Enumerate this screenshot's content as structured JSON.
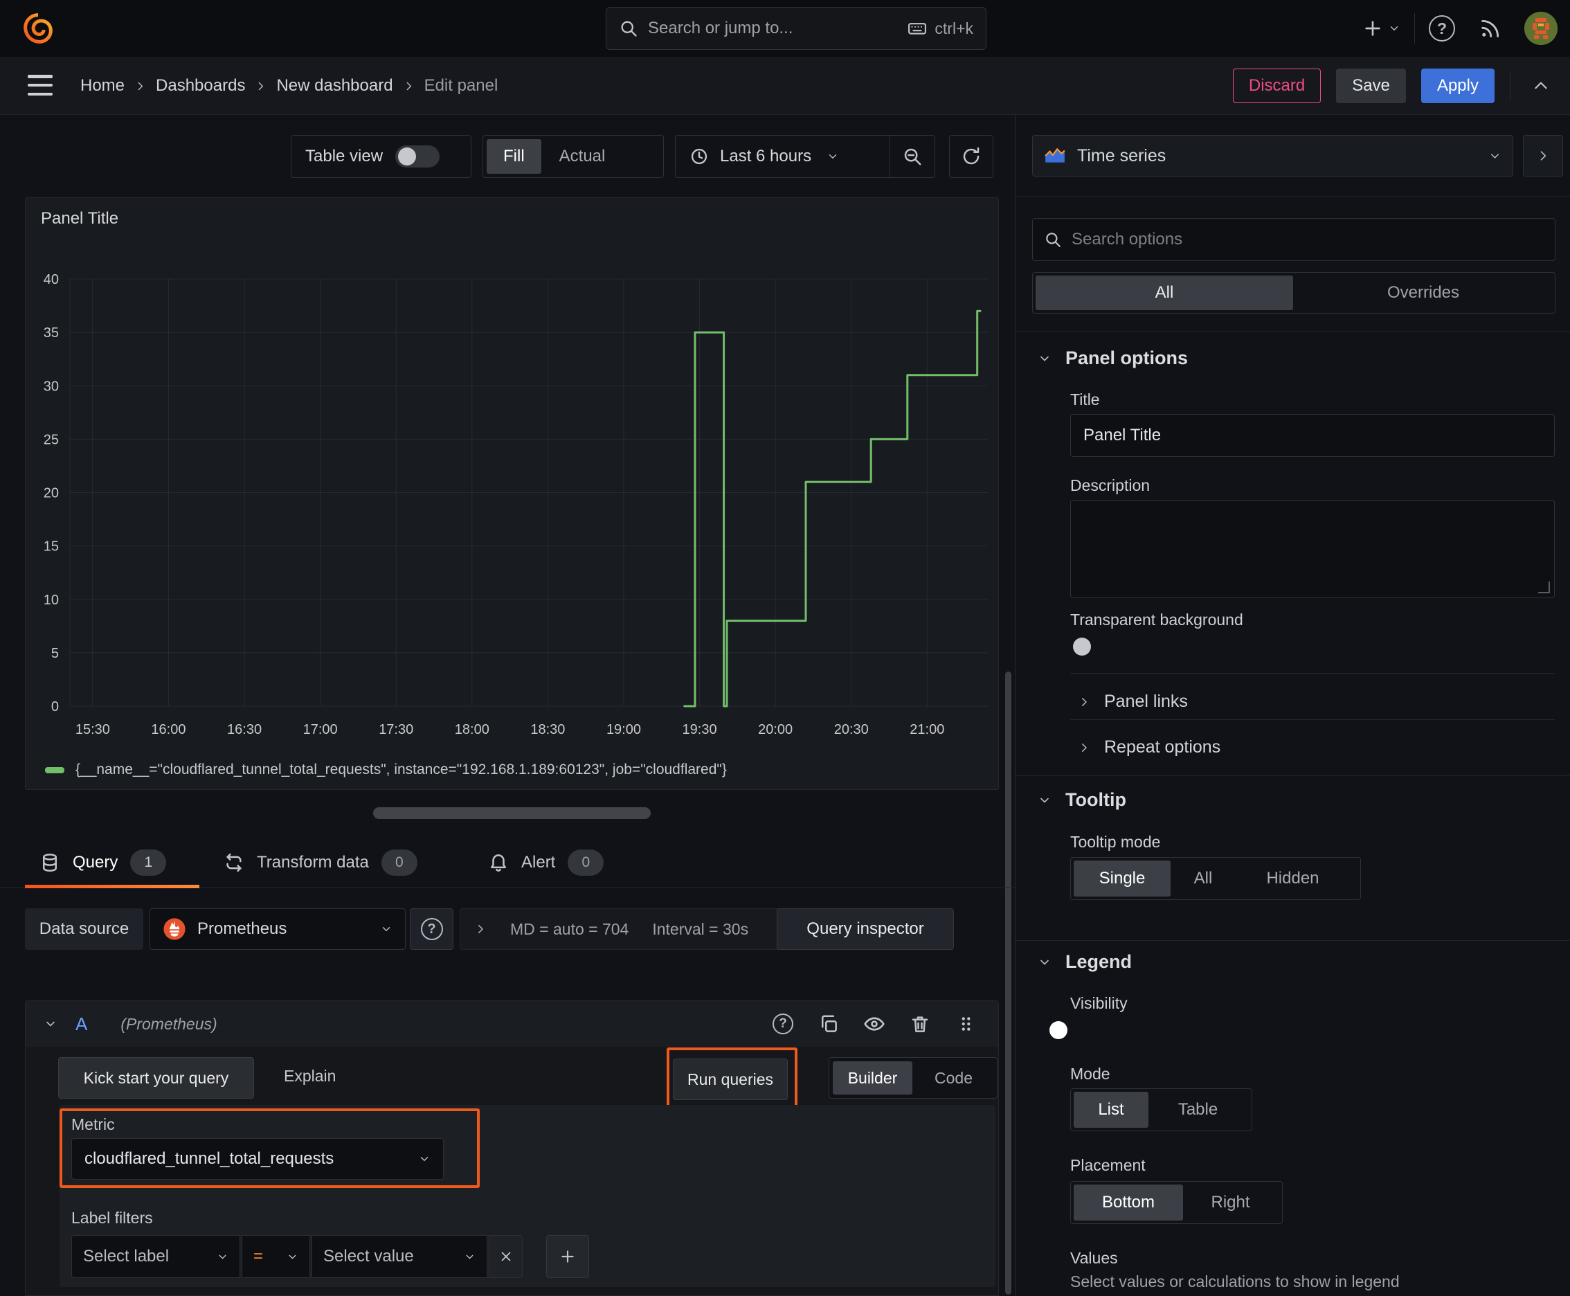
{
  "topnav": {
    "search": {
      "placeholder": "Search or jump to...",
      "shortcut": "ctrl+k"
    }
  },
  "breadcrumb": {
    "items": [
      {
        "label": "Home"
      },
      {
        "label": "Dashboards"
      },
      {
        "label": "New dashboard"
      },
      {
        "label": "Edit panel"
      }
    ],
    "actions": {
      "discard": "Discard",
      "save": "Save",
      "apply": "Apply"
    }
  },
  "toolbar": {
    "table_view": "Table view",
    "fill": "Fill",
    "actual": "Actual",
    "time_range": "Last 6 hours"
  },
  "panel": {
    "title": "Panel Title",
    "legend": "{__name__=\"cloudflared_tunnel_total_requests\", instance=\"192.168.1.189:60123\", job=\"cloudflared\"}"
  },
  "chart_data": {
    "type": "line",
    "title": "Panel Title",
    "xlabel": "",
    "ylabel": "",
    "x_range": [
      15.35,
      21.4
    ],
    "y_range": [
      0,
      40
    ],
    "grid": true,
    "legend_position": "bottom",
    "y_ticks": [
      0,
      5,
      10,
      15,
      20,
      25,
      30,
      35,
      40
    ],
    "x_ticks": [
      {
        "t": 15.5,
        "label": "15:30"
      },
      {
        "t": 16.0,
        "label": "16:00"
      },
      {
        "t": 16.5,
        "label": "16:30"
      },
      {
        "t": 17.0,
        "label": "17:00"
      },
      {
        "t": 17.5,
        "label": "17:30"
      },
      {
        "t": 18.0,
        "label": "18:00"
      },
      {
        "t": 18.5,
        "label": "18:30"
      },
      {
        "t": 19.0,
        "label": "19:00"
      },
      {
        "t": 19.5,
        "label": "19:30"
      },
      {
        "t": 20.0,
        "label": "20:00"
      },
      {
        "t": 20.5,
        "label": "20:30"
      },
      {
        "t": 21.0,
        "label": "21:00"
      }
    ],
    "series": [
      {
        "name": "{__name__=\"cloudflared_tunnel_total_requests\", instance=\"192.168.1.189:60123\", job=\"cloudflared\"}",
        "color": "#73bf69",
        "points": [
          [
            19.4,
            0
          ],
          [
            19.47,
            0
          ],
          [
            19.47,
            35
          ],
          [
            19.66,
            35
          ],
          [
            19.66,
            0
          ],
          [
            19.68,
            0
          ],
          [
            19.68,
            8
          ],
          [
            20.2,
            8
          ],
          [
            20.2,
            21
          ],
          [
            20.63,
            21
          ],
          [
            20.63,
            25
          ],
          [
            20.87,
            25
          ],
          [
            20.87,
            31
          ],
          [
            21.33,
            31
          ],
          [
            21.33,
            37
          ],
          [
            21.35,
            37
          ]
        ]
      }
    ]
  },
  "tabs": {
    "query": {
      "label": "Query",
      "count": "1"
    },
    "transform": {
      "label": "Transform data",
      "count": "0"
    },
    "alert": {
      "label": "Alert",
      "count": "0"
    }
  },
  "datasource": {
    "label": "Data source",
    "name": "Prometheus",
    "stats_md": "MD = auto = 704",
    "stats_interval": "Interval = 30s",
    "inspector": "Query inspector"
  },
  "query_editor": {
    "ref_id": "A",
    "ds_hint": "(Prometheus)",
    "kick_start": "Kick start your query",
    "explain": "Explain",
    "run_queries": "Run queries",
    "builder": "Builder",
    "code": "Code",
    "metric_label": "Metric",
    "metric_value": "cloudflared_tunnel_total_requests",
    "label_filters": "Label filters",
    "select_label": "Select label",
    "operator": "=",
    "select_value": "Select value"
  },
  "sidebar": {
    "viz_type": "Time series",
    "search_placeholder": "Search options",
    "tab_all": "All",
    "tab_overrides": "Overrides",
    "panel_options": {
      "title": "Panel options",
      "title_label": "Title",
      "title_value": "Panel Title",
      "description_label": "Description",
      "transparent_label": "Transparent background",
      "panel_links": "Panel links",
      "repeat_options": "Repeat options"
    },
    "tooltip": {
      "title": "Tooltip",
      "mode_label": "Tooltip mode",
      "single": "Single",
      "all": "All",
      "hidden": "Hidden"
    },
    "legend": {
      "title": "Legend",
      "visibility_label": "Visibility",
      "mode_label": "Mode",
      "list": "List",
      "table": "Table",
      "placement_label": "Placement",
      "bottom": "Bottom",
      "right": "Right",
      "values_label": "Values",
      "values_hint": "Select values or calculations to show in legend"
    }
  },
  "colors": {
    "accent_orange": "#ee5a1d",
    "series_green": "#73bf69",
    "primary_blue": "#3d71d9",
    "destructive_pink": "#ef4d82"
  }
}
